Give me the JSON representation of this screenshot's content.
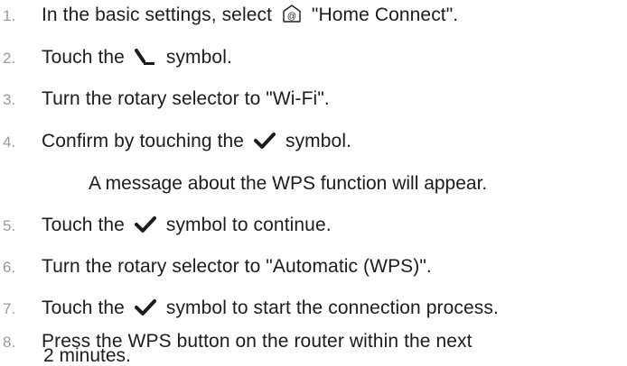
{
  "steps": [
    {
      "num": "1.",
      "before": "In the basic settings, select",
      "after": "\"Home Connect\".",
      "icon": "home-connect-icon"
    },
    {
      "num": "2.",
      "before": "Touch the",
      "after": "symbol.",
      "icon": "settings-symbol-icon"
    },
    {
      "num": "3.",
      "text": "Turn the rotary selector to \"Wi-Fi\"."
    },
    {
      "num": "4.",
      "before": "Confirm by touching the",
      "after": "symbol.",
      "icon": "check-icon"
    },
    {
      "num": "5.",
      "before": "Touch the",
      "after": "symbol to continue.",
      "icon": "check-icon"
    },
    {
      "num": "6.",
      "text": "Turn the rotary selector to \"Automatic (WPS)\"."
    },
    {
      "num": "7.",
      "before": "Touch the",
      "after": "symbol to start the connection process.",
      "icon": "check-icon"
    },
    {
      "num": "8.",
      "line1": "Press the WPS button on the router within the next",
      "line2": "2 minutes."
    }
  ],
  "note_after_step4": "A message about the WPS function will appear.",
  "colors": {
    "text": "#1c1c1c",
    "number": "#9a9a9a"
  }
}
